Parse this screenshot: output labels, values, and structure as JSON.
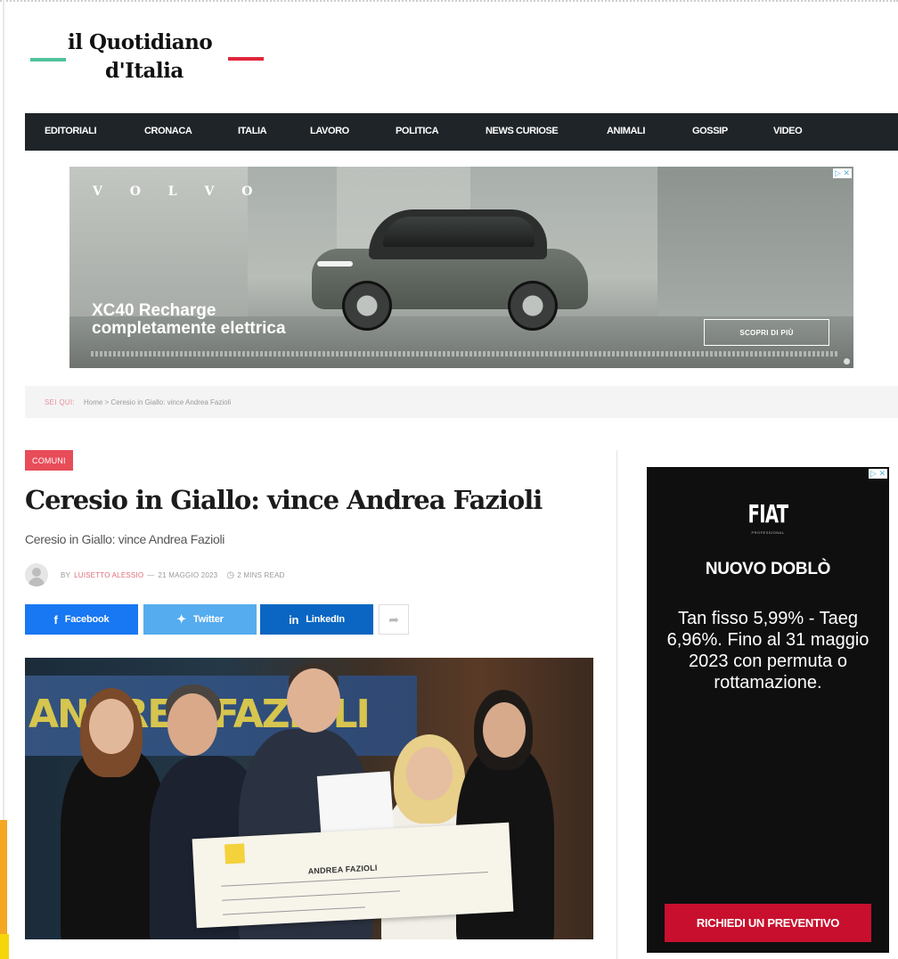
{
  "logo": {
    "line1": "il Quotidiano",
    "line2": "d'Italia",
    "accent_green": "#4fc39c",
    "accent_red": "#e0263b"
  },
  "nav": {
    "items": [
      "EDITORIALI",
      "CRONACA",
      "ITALIA",
      "LAVORO",
      "POLITICA",
      "NEWS CURIOSE",
      "ANIMALI",
      "GOSSIP",
      "VIDEO"
    ],
    "background": "#1f2428"
  },
  "ad_volvo": {
    "brand": "V O L V O",
    "headline1": "XC40 Recharge",
    "headline2": "completamente elettrica",
    "cta": "SCOPRI DI PIÙ",
    "adchoices": "▷ ✕"
  },
  "breadcrumb": {
    "prefix": "SEI QUI:",
    "trail": "Home > Ceresio in Giallo: vince Andrea Fazioli"
  },
  "article": {
    "category": "COMUNI",
    "title": "Ceresio in Giallo: vince Andrea Fazioli",
    "subtitle": "Ceresio in Giallo: vince Andrea Fazioli",
    "meta": {
      "by": "BY",
      "author": "LUISETTO ALESSIO",
      "separator": "—",
      "date": "21 MAGGIO 2023",
      "read_time": "2 MINS READ"
    },
    "share": {
      "facebook": "Facebook",
      "twitter": "Twitter",
      "linkedin": "LinkedIn"
    },
    "photo": {
      "banner_text": "ANDREA FAZIOLI",
      "check_name": "ANDREA FAZIOLI"
    }
  },
  "ad_fiat": {
    "brand": "FIAT",
    "brand_sub": "PROFESSIONAL",
    "model": "NUOVO DOBLÒ",
    "text": "Tan fisso 5,99% - Taeg 6,96%. Fino al 31 maggio 2023 con permuta o rottamazione.",
    "cta": "RICHIEDI UN PREVENTIVO",
    "adchoices": "▷ ✕"
  }
}
